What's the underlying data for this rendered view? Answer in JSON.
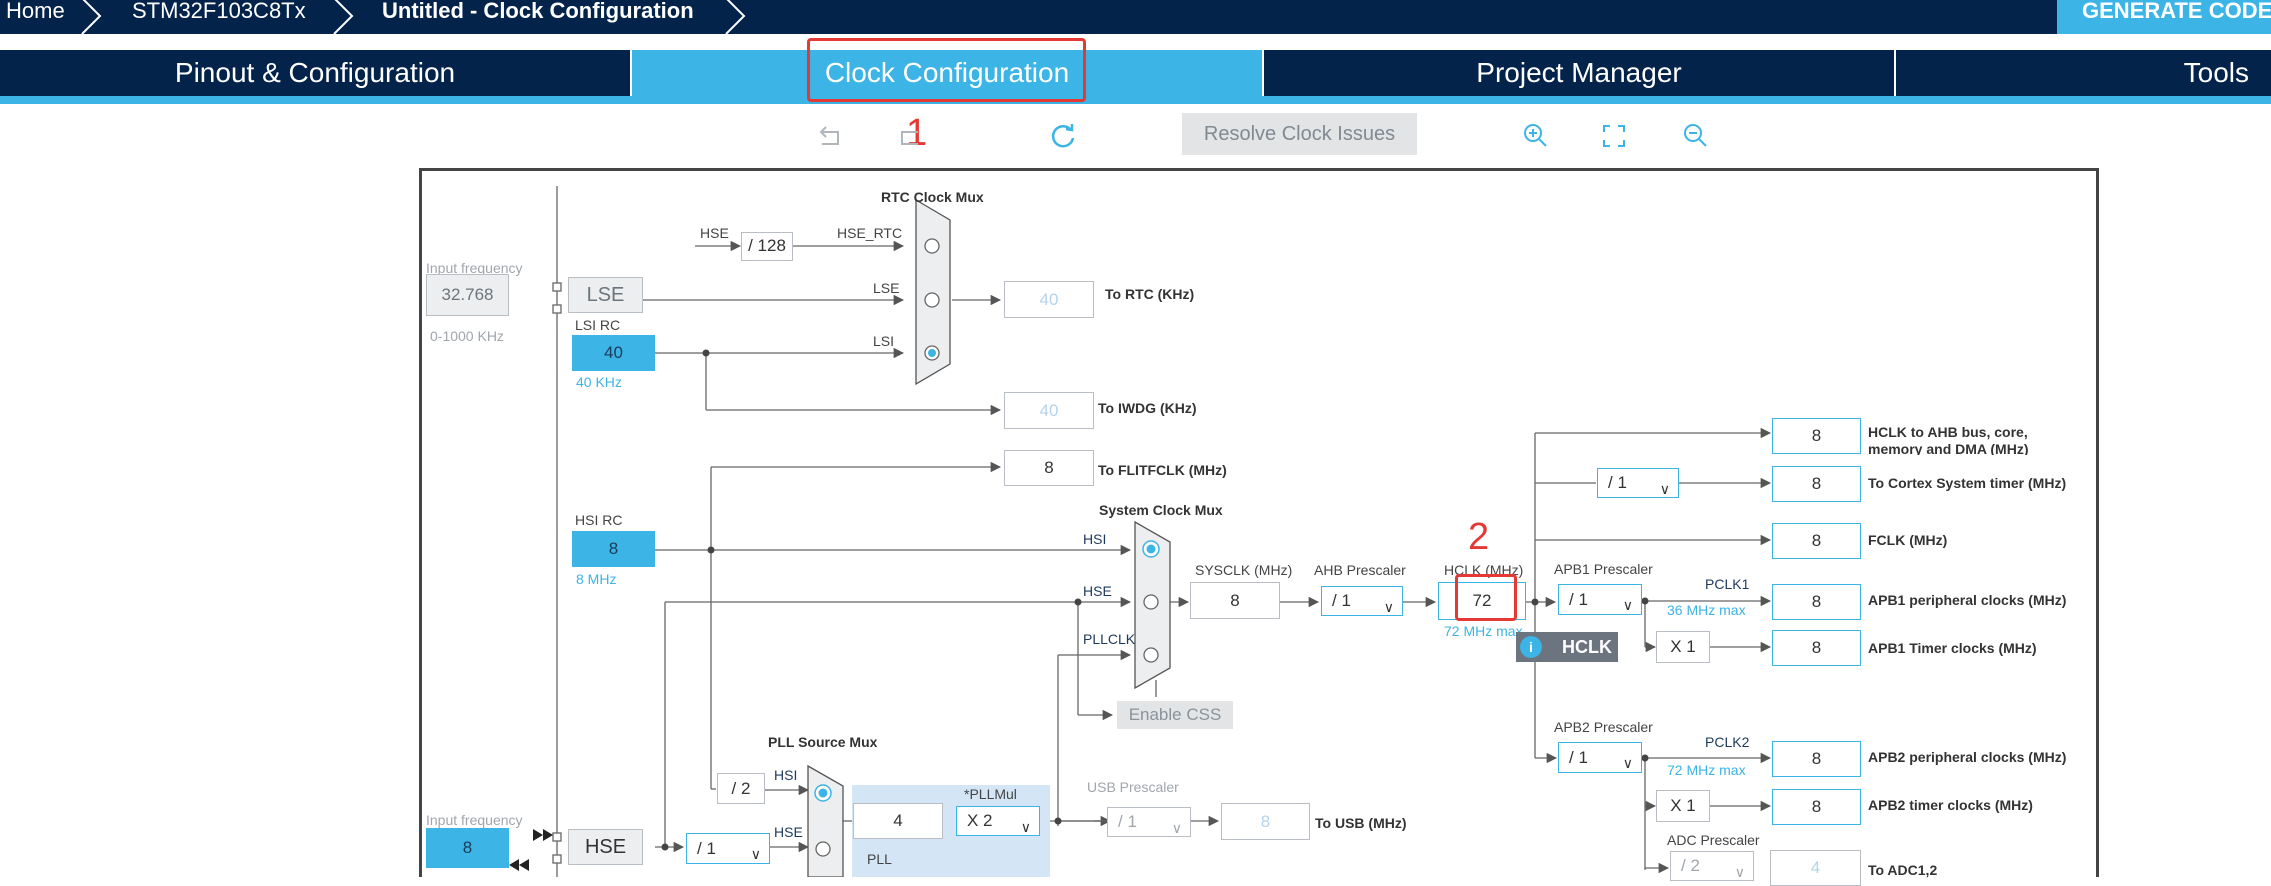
{
  "breadcrumb": {
    "home": "Home",
    "device": "STM32F103C8Tx",
    "project": "Untitled - Clock Configuration"
  },
  "generate_button": "GENERATE CODE",
  "tabs": [
    {
      "label": "Pinout & Configuration"
    },
    {
      "label": "Clock Configuration"
    },
    {
      "label": "Project Manager"
    },
    {
      "label": "Tools"
    }
  ],
  "toolbar": {
    "resolve_label": "Resolve Clock Issues",
    "icons": [
      "undo-icon",
      "redo-icon",
      "refresh-icon",
      "zoom-in-icon",
      "fit-screen-icon",
      "zoom-out-icon"
    ]
  },
  "annotations": {
    "n1": "1",
    "n2": "2"
  },
  "colors": {
    "navy": "#03234b",
    "accent": "#3cb4e6",
    "annotation": "#e53935"
  },
  "diagram": {
    "rtc_mux": {
      "title": "RTC Clock Mux",
      "hse_in": "HSE",
      "div_128": "/ 128",
      "hse_rtc": "HSE_RTC",
      "lse_line": "LSE",
      "lsi_line": "LSI"
    },
    "lse": {
      "input_label": "Input frequency",
      "value": "32.768",
      "range": "0-1000 KHz",
      "name": "LSE"
    },
    "lsi": {
      "title": "LSI RC",
      "value": "40",
      "freq": "40 KHz"
    },
    "rtc_out": {
      "value": "40",
      "label": "To RTC (KHz)"
    },
    "iwdg_out": {
      "value": "40",
      "label": "To IWDG (KHz)"
    },
    "flitf_out": {
      "value": "8",
      "label": "To FLITFCLK (MHz)"
    },
    "hsi": {
      "title": "HSI RC",
      "value": "8",
      "freq": "8 MHz"
    },
    "sys_mux": {
      "title": "System Clock Mux",
      "hsi": "HSI",
      "hse": "HSE",
      "pllclk": "PLLCLK"
    },
    "sysclk": {
      "label": "SYSCLK (MHz)",
      "value": "8"
    },
    "ahb": {
      "label": "AHB Prescaler",
      "value": "/ 1"
    },
    "hclk": {
      "label": "HCLK (MHz)",
      "value": "72",
      "max": "72 MHz max",
      "tip": "HCLK"
    },
    "enable_css": "Enable CSS",
    "apb1": {
      "label": "APB1 Prescaler",
      "value": "/ 1",
      "pclk": "PCLK1",
      "max": "36 MHz max",
      "timer_mul": "X 1"
    },
    "apb2": {
      "label": "APB2 Prescaler",
      "value": "/ 1",
      "pclk": "PCLK2",
      "max": "72 MHz max",
      "timer_mul": "X 1"
    },
    "cortex_div": "/ 1",
    "adc": {
      "label": "ADC Prescaler",
      "value": "/ 2",
      "out_value": "4",
      "out_label": "To ADC1,2"
    },
    "outputs": [
      {
        "value": "8",
        "label": "HCLK to AHB bus, core,",
        "label2": "memory and DMA (MHz)"
      },
      {
        "value": "8",
        "label": "To Cortex System timer (MHz)"
      },
      {
        "value": "8",
        "label": "FCLK (MHz)"
      },
      {
        "value": "8",
        "label": "APB1 peripheral clocks (MHz)"
      },
      {
        "value": "8",
        "label": "APB1 Timer clocks (MHz)"
      },
      {
        "value": "8",
        "label": "APB2 peripheral clocks (MHz)"
      },
      {
        "value": "8",
        "label": "APB2 timer clocks (MHz)"
      }
    ],
    "pll_src": {
      "title": "PLL Source Mux",
      "hsi_div": "/ 2",
      "hsi": "HSI",
      "hse": "HSE"
    },
    "hse": {
      "input_label": "Input frequency",
      "value": "8",
      "name": "HSE",
      "div": "/ 1"
    },
    "pll": {
      "title": "PLL",
      "value": "4",
      "mul_label": "*PLLMul",
      "mul": "X 2"
    },
    "usb": {
      "label": "USB Prescaler",
      "value": "/ 1",
      "out_value": "8",
      "out_label": "To USB (MHz)"
    }
  }
}
